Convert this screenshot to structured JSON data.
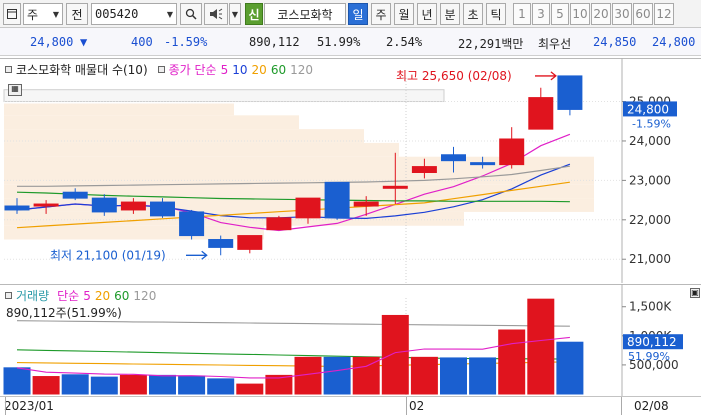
{
  "toolbar": {
    "period_label": "주",
    "prev_label": "전",
    "code_value": "005420",
    "search_icon": "search-icon",
    "sound_icon": "speaker-icon",
    "sin_label": "신",
    "stock_name": "코스모화학",
    "intervals": [
      "일",
      "주",
      "월",
      "년",
      "분",
      "초",
      "틱"
    ],
    "active_interval": "일",
    "numbers": [
      "1",
      "3",
      "5",
      "10",
      "20",
      "30",
      "60",
      "12"
    ]
  },
  "quote": {
    "price": "24,800",
    "direction": "▼",
    "change": "400",
    "change_pct": "-1.59%",
    "volume": "890,112",
    "turnover_pct": "51.99%",
    "extra_pct": "2.54%",
    "amount": "22,291백만",
    "best_ask_label": "최우선",
    "best_ask": "24,850",
    "best_bid": "24,800"
  },
  "price_panel": {
    "legend_title": "코스모화학 매물대 수(10)",
    "ma_label": "종가 단순",
    "ma_periods": [
      "5",
      "10",
      "20",
      "60",
      "120"
    ],
    "ma_colors": [
      "#e020c8",
      "#1a3fd6",
      "#f0a000",
      "#1e9a2a",
      "#9a9a9a"
    ],
    "high_label": "최고 25,650 (02/08)",
    "low_label": "최저 21,100 (01/19)",
    "current_price_tag": "24,800",
    "current_pct_tag": "-1.59%",
    "y_ticks": [
      "25,000",
      "24,000",
      "23,000",
      "22,000",
      "21,000"
    ]
  },
  "volume_panel": {
    "legend_title": "거래량",
    "ma_label": "단순",
    "ma_periods": [
      "5",
      "20",
      "60",
      "120"
    ],
    "ma_colors": [
      "#e020c8",
      "#f0a000",
      "#1e9a2a",
      "#9a9a9a"
    ],
    "volume_info": "890,112주(51.99%)",
    "current_volume_tag": "890,112",
    "current_pct_tag": "51.99%",
    "y_ticks": [
      "1,500K",
      "1,000K",
      "500,000"
    ]
  },
  "date_axis": {
    "labels": [
      "2023/01",
      "02",
      "02/08"
    ]
  },
  "colors": {
    "up": "#e0141e",
    "down": "#1a5fd0",
    "accent": "#2a6fd6"
  },
  "chart_data": [
    {
      "type": "candlestick",
      "title": "코스모화학",
      "ylim": [
        20600,
        25800
      ],
      "candles": [
        {
          "o": 22350,
          "h": 22550,
          "l": 22150,
          "c": 22250
        },
        {
          "o": 22350,
          "h": 22500,
          "l": 22150,
          "c": 22400
        },
        {
          "o": 22700,
          "h": 22800,
          "l": 22500,
          "c": 22550
        },
        {
          "o": 22550,
          "h": 22650,
          "l": 22100,
          "c": 22200
        },
        {
          "o": 22250,
          "h": 22550,
          "l": 22150,
          "c": 22450
        },
        {
          "o": 22450,
          "h": 22550,
          "l": 22050,
          "c": 22100
        },
        {
          "o": 22200,
          "h": 22250,
          "l": 21500,
          "c": 21600
        },
        {
          "o": 21500,
          "h": 21600,
          "l": 21100,
          "c": 21300
        },
        {
          "o": 21250,
          "h": 21600,
          "l": 21150,
          "c": 21600
        },
        {
          "o": 21750,
          "h": 22100,
          "l": 21750,
          "c": 22050
        },
        {
          "o": 22050,
          "h": 22550,
          "l": 21900,
          "c": 22550
        },
        {
          "o": 22950,
          "h": 22950,
          "l": 22000,
          "c": 22050
        },
        {
          "o": 22350,
          "h": 22600,
          "l": 22100,
          "c": 22450
        },
        {
          "o": 22850,
          "h": 23700,
          "l": 22400,
          "c": 22850
        },
        {
          "o": 23200,
          "h": 23550,
          "l": 23050,
          "c": 23350
        },
        {
          "o": 23650,
          "h": 23850,
          "l": 23200,
          "c": 23500
        },
        {
          "o": 23450,
          "h": 23600,
          "l": 23300,
          "c": 23400
        },
        {
          "o": 23400,
          "h": 24350,
          "l": 23300,
          "c": 24050
        },
        {
          "o": 24300,
          "h": 25350,
          "l": 24300,
          "c": 25100
        },
        {
          "o": 25650,
          "h": 25650,
          "l": 24650,
          "c": 24800
        }
      ]
    },
    {
      "type": "bar",
      "title": "거래량",
      "ylim": [
        0,
        1650000
      ],
      "values": [
        450000,
        300000,
        330000,
        290000,
        320000,
        320000,
        310000,
        260000,
        170000,
        320000,
        630000,
        630000,
        630000,
        1350000,
        630000,
        620000,
        620000,
        1100000,
        1630000,
        890112
      ]
    }
  ]
}
